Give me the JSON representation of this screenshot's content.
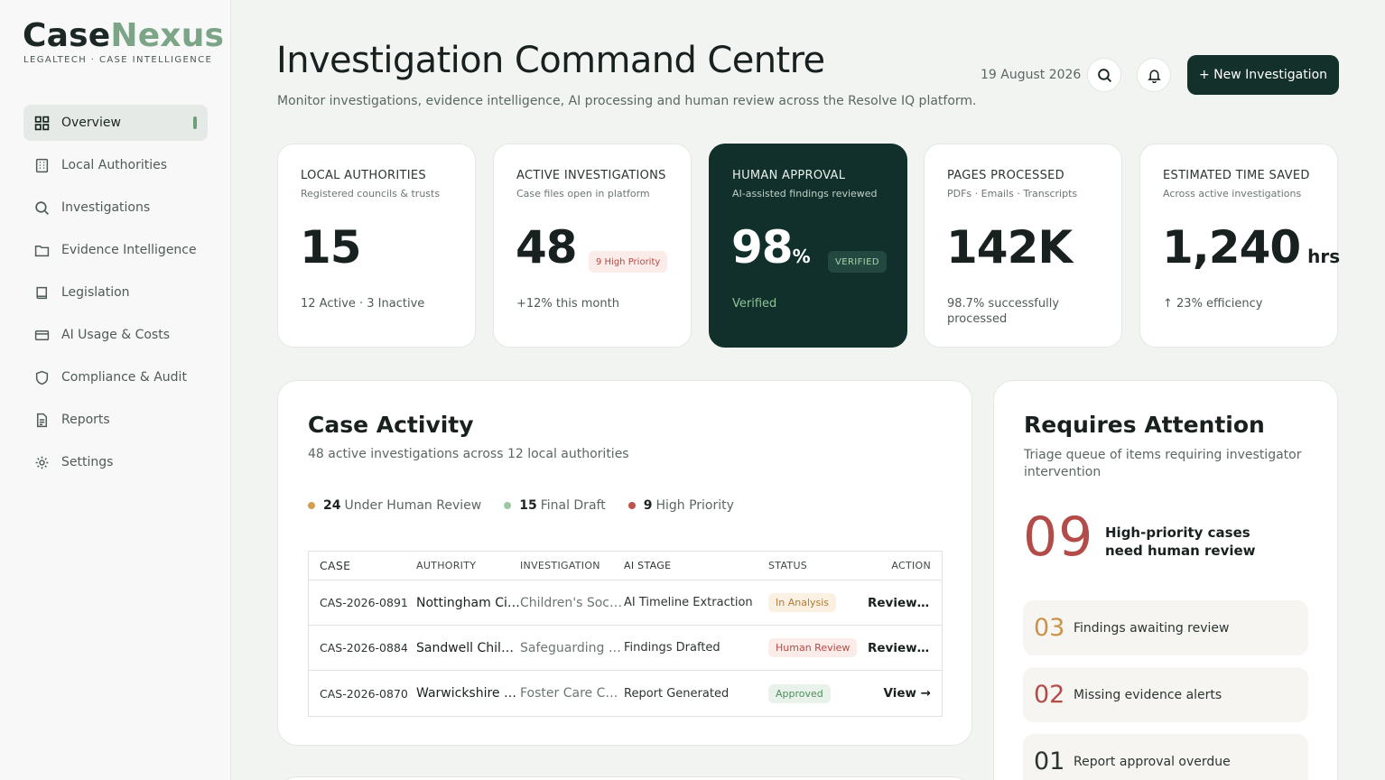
{
  "brand": {
    "name_part1": "Case",
    "name_part2": "Nexus",
    "tagline": "LEGALTECH · CASE INTELLIGENCE"
  },
  "nav": [
    {
      "label": "Overview",
      "icon": "dashboard-icon",
      "active": true
    },
    {
      "label": "Local Authorities",
      "icon": "building-icon"
    },
    {
      "label": "Investigations",
      "icon": "search-icon"
    },
    {
      "label": "Evidence Intelligence",
      "icon": "folder-icon"
    },
    {
      "label": "Legislation",
      "icon": "book-icon"
    },
    {
      "label": "AI Usage & Costs",
      "icon": "credit-card-icon"
    },
    {
      "label": "Compliance & Audit",
      "icon": "shield-icon"
    },
    {
      "label": "Reports",
      "icon": "document-icon"
    },
    {
      "label": "Settings",
      "icon": "gear-icon"
    }
  ],
  "header": {
    "title": "Investigation Command Centre",
    "subtitle": "Monitor investigations, evidence intelligence, AI processing and human review across the Resolve IQ platform.",
    "date": "19 August 2026",
    "new_button": "+ New Investigation"
  },
  "kpis": [
    {
      "title": "LOCAL AUTHORITIES",
      "sub": "Registered councils & trusts",
      "value": "15",
      "unit": "",
      "badge": "",
      "foot": "12 Active · 3 Inactive"
    },
    {
      "title": "ACTIVE INVESTIGATIONS",
      "sub": "Case files open in platform",
      "value": "48",
      "unit": "",
      "badge": "9 High Priority",
      "foot": "+12% this month"
    },
    {
      "title": "HUMAN APPROVAL",
      "sub": "AI-assisted findings reviewed",
      "value": "98",
      "unit": "%",
      "badge": "VERIFIED",
      "foot": "Verified"
    },
    {
      "title": "PAGES PROCESSED",
      "sub": "PDFs · Emails · Transcripts",
      "value": "142K",
      "unit": "",
      "badge": "",
      "foot": "98.7% successfully processed"
    },
    {
      "title": "ESTIMATED TIME SAVED",
      "sub": "Across active investigations",
      "value": "1,240",
      "unit": "hrs",
      "badge": "",
      "foot": "↑ 23% efficiency"
    }
  ],
  "case_activity": {
    "title": "Case Activity",
    "subtitle": "48 active investigations across 12 local authorities",
    "legend": [
      {
        "count": "24",
        "label": "Under Human Review",
        "color": "#d2a050"
      },
      {
        "count": "15",
        "label": "Final Draft",
        "color": "#9cc8a4"
      },
      {
        "count": "9",
        "label": "High Priority",
        "color": "#c0524c"
      }
    ],
    "columns": [
      "CASE",
      "AUTHORITY",
      "INVESTIGATION",
      "AI STAGE",
      "STATUS",
      "ACTION"
    ],
    "rows": [
      {
        "case": "CAS-2026-0891",
        "authority": "Nottingham City…",
        "investigation": "Children's Social…",
        "stage": "AI Timeline Extraction",
        "status": "In Analysis",
        "action": "Review →"
      },
      {
        "case": "CAS-2026-0884",
        "authority": "Sandwell Childr…",
        "investigation": "Safeguarding Re…",
        "stage": "Findings Drafted",
        "status": "Human Review",
        "action": "Review →"
      },
      {
        "case": "CAS-2026-0870",
        "authority": "Warwickshire C…",
        "investigation": "Foster Care Com…",
        "stage": "Report Generated",
        "status": "Approved",
        "action": "View →"
      }
    ]
  },
  "attention": {
    "title": "Requires Attention",
    "subtitle": "Triage queue of items requiring investigator intervention",
    "headline_count": "09",
    "headline_text": "High-priority cases need human review",
    "items": [
      {
        "count": "03",
        "label": "Findings awaiting review",
        "color": "#c9934a"
      },
      {
        "count": "02",
        "label": "Missing evidence alerts",
        "color": "#b34c49"
      },
      {
        "count": "01",
        "label": "Report approval overdue",
        "color": "#2b3532"
      }
    ]
  }
}
